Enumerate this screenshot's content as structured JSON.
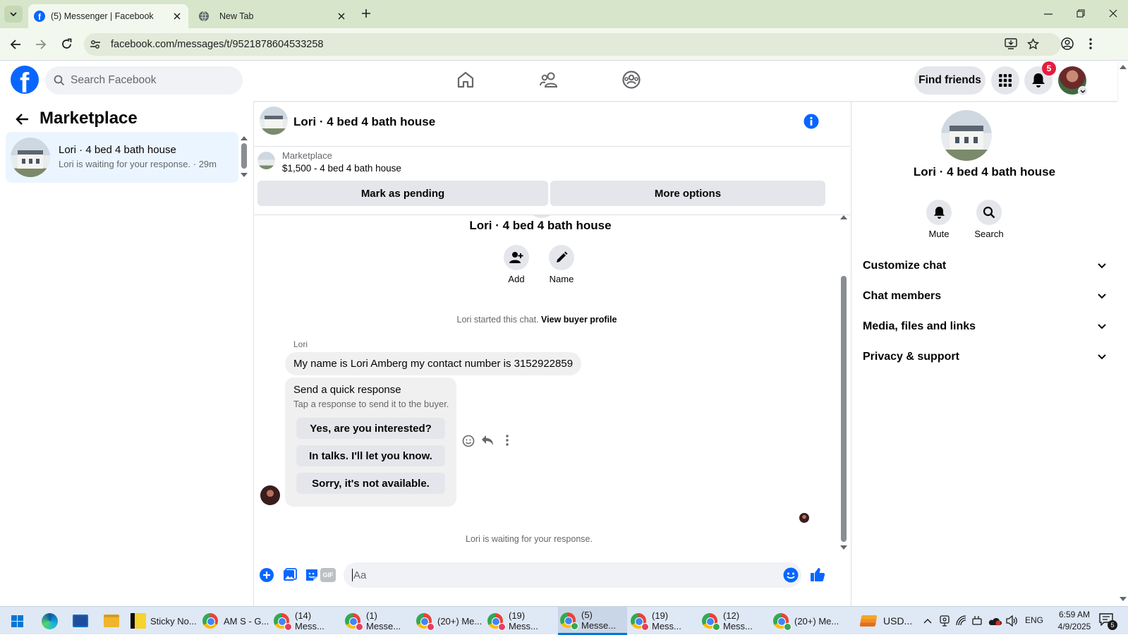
{
  "browser": {
    "tabs": [
      {
        "label": "(5) Messenger | Facebook",
        "active": true
      },
      {
        "label": "New Tab",
        "active": false
      }
    ],
    "url": "facebook.com/messages/t/9521878604533258"
  },
  "fb_header": {
    "search_placeholder": "Search Facebook",
    "find_friends_label": "Find friends",
    "notification_count": "5"
  },
  "left_panel": {
    "title": "Marketplace",
    "conversations": [
      {
        "name": "Lori · 4 bed 4 bath house",
        "preview": "Lori is waiting for your response. · 29m"
      }
    ]
  },
  "chat": {
    "header_title": "Lori · 4 bed 4 bath house",
    "listing_source": "Marketplace",
    "listing_title": "$1,500 - 4 bed 4 bath house",
    "mark_pending_label": "Mark as pending",
    "more_options_label": "More options",
    "intro_title": "Lori · 4 bed 4 bath house",
    "add_label": "Add",
    "name_label": "Name",
    "started_text": "Lori started this chat.",
    "view_buyer_label": "View buyer profile",
    "sender_name": "Lori",
    "message_text": "My name is Lori Amberg my contact number is 3152922859",
    "quick_title": "Send a quick response",
    "quick_sub": "Tap a response to send it to the buyer.",
    "quick_responses": [
      "Yes, are you interested?",
      "In talks. I'll let you know.",
      "Sorry, it's not available."
    ],
    "waiting_text": "Lori is waiting for your response.",
    "composer_placeholder": "Aa"
  },
  "right_panel": {
    "title": "Lori · 4 bed 4 bath house",
    "mute_label": "Mute",
    "search_label": "Search",
    "sections": [
      "Customize chat",
      "Chat members",
      "Media, files and links",
      "Privacy & support"
    ]
  },
  "taskbar": {
    "items": [
      {
        "label": "Sticky No...",
        "icon": "sticky-notes-icon"
      },
      {
        "label": "AM S - G...",
        "icon": "chrome-icon"
      },
      {
        "label": "(14) Mess...",
        "icon": "chrome-icon"
      },
      {
        "label": "(1) Messe...",
        "icon": "chrome-icon"
      },
      {
        "label": "(20+) Me...",
        "icon": "chrome-icon"
      },
      {
        "label": "(19) Mess...",
        "icon": "chrome-icon"
      },
      {
        "label": "(5) Messe...",
        "icon": "chrome-icon"
      },
      {
        "label": "(19) Mess...",
        "icon": "chrome-icon"
      },
      {
        "label": "(12) Mess...",
        "icon": "chrome-icon"
      },
      {
        "label": "(20+) Me...",
        "icon": "chrome-icon"
      }
    ],
    "currency": "USD...",
    "language": "ENG",
    "time": "6:59 AM",
    "date": "4/9/2025",
    "notif_count": "5"
  },
  "colors": {
    "fb_blue": "#0866ff",
    "red_badge": "#e41e3f",
    "chrome_tab_bg": "#d7e6cb",
    "chrome_toolbar": "#f3f8ee"
  }
}
